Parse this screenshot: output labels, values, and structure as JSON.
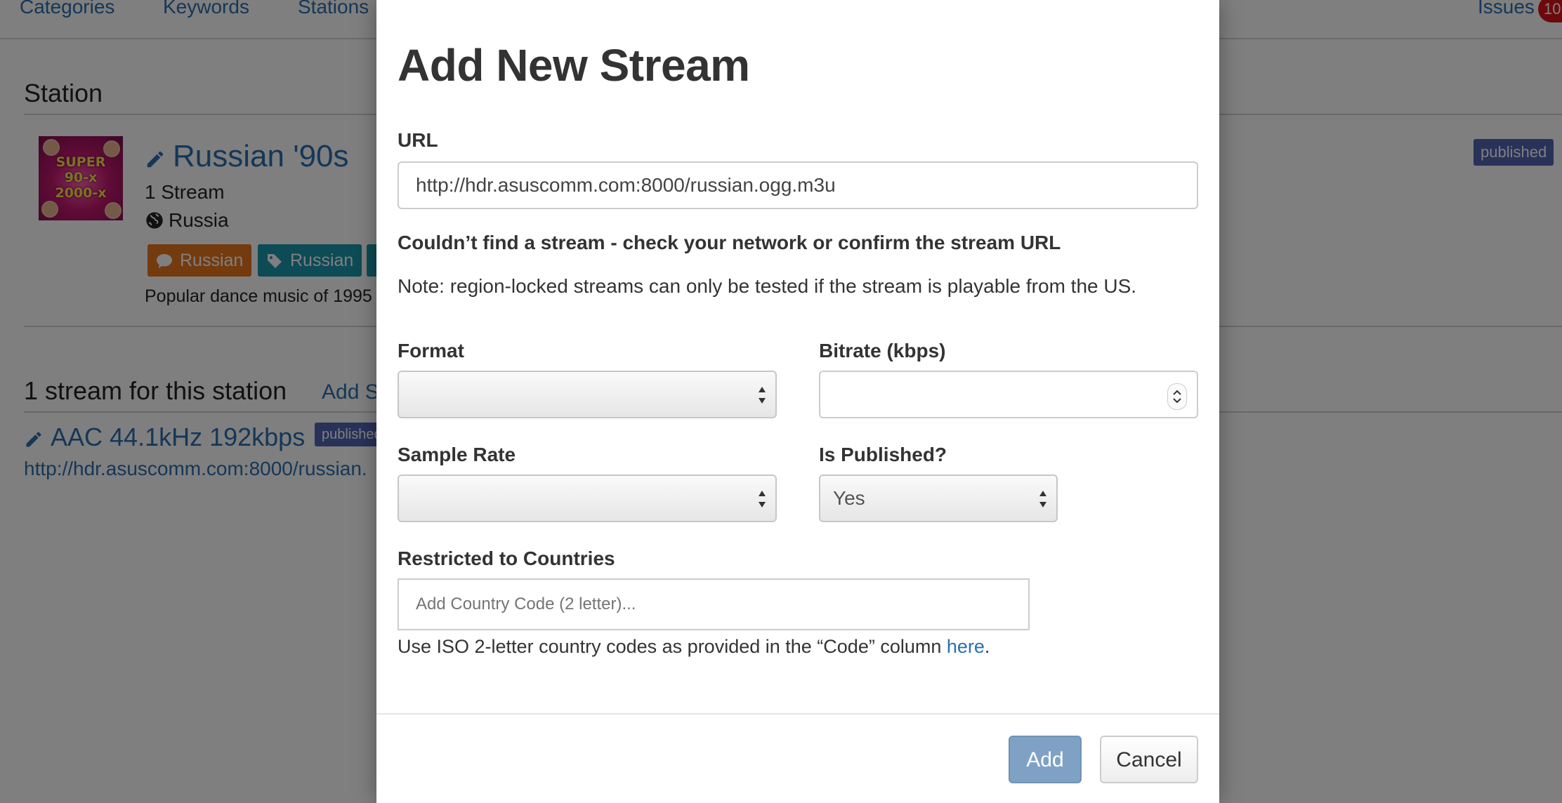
{
  "nav": {
    "categories": "Categories",
    "keywords": "Keywords",
    "stations": "Stations",
    "issues": "Issues",
    "issues_count": "10"
  },
  "station_section": {
    "heading": "Station",
    "name": "Russian '90s",
    "stream_count": "1 Stream",
    "country": "Russia",
    "tags": [
      {
        "label": "Russian",
        "kind": "language",
        "color": "#e8771f"
      },
      {
        "label": "Russian",
        "kind": "category",
        "color": "#1b96ad"
      }
    ],
    "description": "Popular dance music of 1995",
    "status": "published",
    "cover_text": "SUPER 90-x 2000-x"
  },
  "streams_section": {
    "heading": "1 stream for this station",
    "add_link": "Add S",
    "stream_name": "AAC 44.1kHz 192kbps",
    "stream_status": "published",
    "stream_url": "http://hdr.asuscomm.com:8000/russian."
  },
  "modal": {
    "title": "Add New Stream",
    "url_label": "URL",
    "url_value": "http://hdr.asuscomm.com:8000/russian.ogg.m3u",
    "error_message": "Couldn’t find a stream - check your network or confirm the stream URL",
    "note": "Note: region-locked streams can only be tested if the stream is playable from the US.",
    "format_label": "Format",
    "format_value": "",
    "bitrate_label": "Bitrate (kbps)",
    "bitrate_value": "",
    "sample_rate_label": "Sample Rate",
    "sample_rate_value": "",
    "published_label": "Is Published?",
    "published_value": "Yes",
    "countries_label": "Restricted to Countries",
    "countries_placeholder": "Add Country Code (2 letter)...",
    "help_text_before": "Use ISO 2-letter country codes as provided in the “Code” column ",
    "help_link": "here",
    "help_text_after": ".",
    "add_button": "Add",
    "cancel_button": "Cancel"
  },
  "colors": {
    "link": "#2a6fb0",
    "badge_published": "#5264b2",
    "issues_badge": "#d9131b",
    "add_button": "#7fa2c4"
  }
}
